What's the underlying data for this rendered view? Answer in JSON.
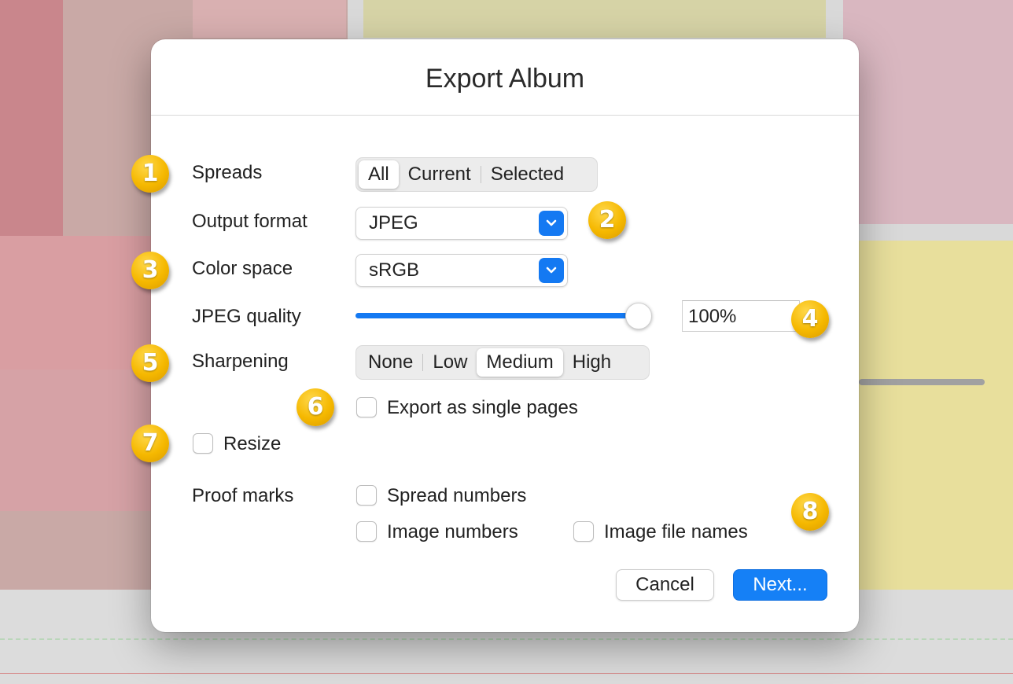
{
  "dialog": {
    "title": "Export Album"
  },
  "spreads": {
    "label": "Spreads",
    "options": [
      "All",
      "Current",
      "Selected"
    ],
    "selected": "All"
  },
  "output_format": {
    "label": "Output format",
    "value": "JPEG"
  },
  "color_space": {
    "label": "Color space",
    "value": "sRGB"
  },
  "jpeg_quality": {
    "label": "JPEG quality",
    "value_text": "100%",
    "level": 1.0
  },
  "sharpening": {
    "label": "Sharpening",
    "options": [
      "None",
      "Low",
      "Medium",
      "High"
    ],
    "selected": "Medium"
  },
  "export_single_pages": {
    "label": "Export as single pages",
    "checked": false
  },
  "resize": {
    "label": "Resize",
    "checked": false
  },
  "proof_marks": {
    "label": "Proof marks",
    "spread_numbers": "Spread numbers",
    "image_numbers": "Image numbers",
    "image_file_names": "Image file names"
  },
  "buttons": {
    "cancel": "Cancel",
    "next": "Next..."
  },
  "markers": [
    "1",
    "2",
    "3",
    "4",
    "5",
    "6",
    "7",
    "8"
  ],
  "colors": {
    "accent": "#1479f2",
    "marker": "#f5b800"
  }
}
